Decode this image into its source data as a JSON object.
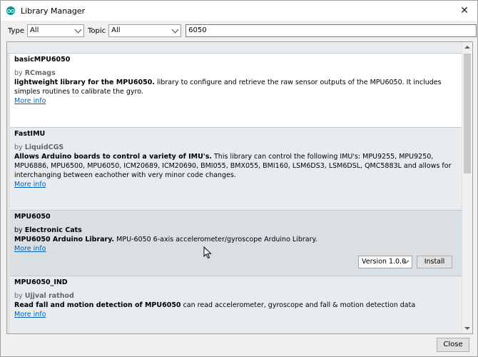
{
  "window": {
    "title": "Library Manager",
    "close_glyph": "✕"
  },
  "filters": {
    "type_label": "Type",
    "type_value": "All",
    "topic_label": "Topic",
    "topic_value": "All",
    "search_value": "6050"
  },
  "libraries": [
    {
      "name": "basicMPU6050",
      "by_prefix": "by",
      "author": "RCmags",
      "desc_bold": "lightweight library for the MPU6050.",
      "desc": " library to configure and retrieve the raw sensor outputs of the MPU6050. It includes simples routines to calibrate the gyro.",
      "more": "More info"
    },
    {
      "name": "FastIMU",
      "by_prefix": "by",
      "author": "LiquidCGS",
      "desc_bold": "Allows Arduino boards to control a variety of IMU's.",
      "desc": " This library can control the following IMU's: MPU9255, MPU9250, MPU6886, MPU6500, MPU6050, ICM20689, ICM20690, BMI055, BMX055, BMI160, LSM6DS3, LSM6DSL, QMC5883L and allows for interchanging between eachother with very minor code changes.",
      "more": "More info"
    },
    {
      "name": "MPU6050",
      "by_prefix": "by",
      "author": "Electronic Cats",
      "desc_bold": "MPU6050 Arduino Library.",
      "desc": " MPU-6050 6-axis accelerometer/gyroscope Arduino Library.",
      "more": "More info",
      "version_label": "Version 1.0.0",
      "install_label": "Install"
    },
    {
      "name": "MPU6050_IND",
      "by_prefix": "by",
      "author": "Ujjval rathod",
      "desc_bold": "Read fall and motion detection of MPU6050",
      "desc": " can read accelerometer, gyroscope and fall & motion detection data",
      "more": "More info"
    }
  ],
  "footer": {
    "close_label": "Close"
  },
  "icons": {
    "app": "arduino-icon",
    "close": "close-icon",
    "dropdown": "chevron-down-icon",
    "cursor": "mouse-pointer-icon"
  }
}
